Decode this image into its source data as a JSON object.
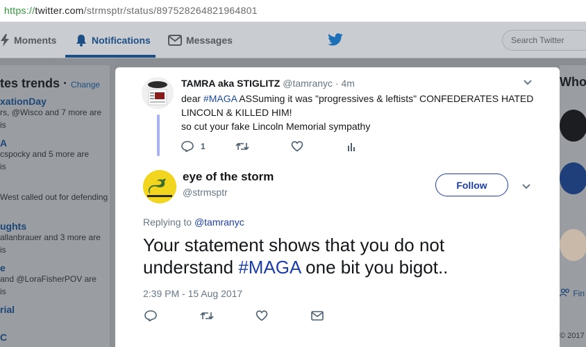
{
  "browser": {
    "url_scheme": "https://",
    "url_host": "twitter.com",
    "url_path": "/strmsptr/status/897528264821964801"
  },
  "nav": {
    "moments_label": "Moments",
    "notifications_label": "Notifications",
    "messages_label": "Messages",
    "search_placeholder": "Search Twitter"
  },
  "trends": {
    "title": "tes trends",
    "change_label": "Change",
    "items": [
      {
        "name": "xationDay",
        "desc": "rs, @Wisco and 7 more are"
      },
      {
        "name": "",
        "desc": "is"
      },
      {
        "name": "A",
        "desc": "cspocky and 5 more are"
      },
      {
        "name": "",
        "desc": "is"
      },
      {
        "name": "",
        "desc": "West called out for defending"
      },
      {
        "name": "ughts",
        "desc": "allanbrauer and 3 more are"
      },
      {
        "name": "",
        "desc": "is"
      },
      {
        "name": "e",
        "desc": "and @LoraFisherPOV are"
      },
      {
        "name": "",
        "desc": "is"
      },
      {
        "name": "rial",
        "desc": ""
      },
      {
        "name": "C",
        "desc": ""
      }
    ]
  },
  "right": {
    "who_title": "Who",
    "find_label": "Fin",
    "copyright": "© 2017"
  },
  "parent_tweet": {
    "name": "TAMRA aka STIGLITZ",
    "handle": "@tamranyc",
    "time": "· 4m",
    "text_prefix": "dear ",
    "hashtag": "#MAGA",
    "text_line1_rest": " ASSuming it was \"progressives & leftists\" CONFEDERATES HATED",
    "text_line2": "LINCOLN & KILLED HIM!",
    "text_line3": "so cut your fake Lincoln Memorial sympathy",
    "reply_count": "1"
  },
  "main_tweet": {
    "name": "eye of the storm",
    "handle": "@strmsptr",
    "follow_label": "Follow",
    "replying_prefix": "Replying to ",
    "replying_to": "@tamranyc",
    "text_part1": "Your statement shows that you do not understand ",
    "hashtag": "#MAGA",
    "text_part2": " one bit you bigot..",
    "timestamp": "2:39 PM - 15 Aug 2017"
  },
  "colors": {
    "accent": "#1c3da8",
    "twitter_blue": "#1da1f2",
    "thread_line": "#a9b1f0"
  }
}
